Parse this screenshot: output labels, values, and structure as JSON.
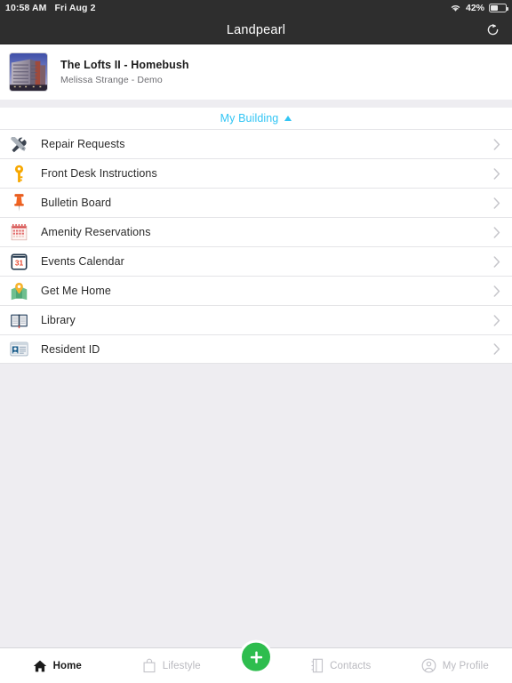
{
  "status_bar": {
    "time": "10:58 AM",
    "date": "Fri Aug 2",
    "wifi_icon": "wifi-icon",
    "battery_percent": "42%",
    "battery_icon": "battery-icon"
  },
  "nav_bar": {
    "title": "Landpearl",
    "refresh_icon": "refresh-icon"
  },
  "building": {
    "thumbnail_icon": "building-photo",
    "name": "The Lofts II - Homebush",
    "subtitle": "Melissa Strange - Demo"
  },
  "section": {
    "label": "My Building",
    "caret_icon": "caret-up-icon",
    "expanded": true
  },
  "menu_items": [
    {
      "label": "Repair Requests",
      "icon": "tools-icon",
      "chevron": "chevron-right-icon"
    },
    {
      "label": "Front Desk Instructions",
      "icon": "key-icon",
      "chevron": "chevron-right-icon"
    },
    {
      "label": "Bulletin Board",
      "icon": "pushpin-icon",
      "chevron": "chevron-right-icon"
    },
    {
      "label": "Amenity Reservations",
      "icon": "calendar-grid-icon",
      "chevron": "chevron-right-icon"
    },
    {
      "label": "Events Calendar",
      "icon": "calendar-31-icon",
      "chevron": "chevron-right-icon"
    },
    {
      "label": "Get Me Home",
      "icon": "map-pin-icon",
      "chevron": "chevron-right-icon"
    },
    {
      "label": "Library",
      "icon": "open-book-icon",
      "chevron": "chevron-right-icon"
    },
    {
      "label": "Resident ID",
      "icon": "id-card-icon",
      "chevron": "chevron-right-icon"
    }
  ],
  "tab_bar": {
    "tabs": [
      {
        "label": "Home",
        "icon": "home-icon",
        "active": true
      },
      {
        "label": "Lifestyle",
        "icon": "shopping-bag-icon",
        "active": false
      },
      {
        "label": "Contacts",
        "icon": "address-book-icon",
        "active": false
      },
      {
        "label": "My Profile",
        "icon": "person-circle-icon",
        "active": false
      }
    ],
    "fab": {
      "icon": "plus-icon",
      "label": "+"
    }
  },
  "colors": {
    "nav_background": "#2e2e2e",
    "accent_cyan": "#32c5f4",
    "fab_green": "#2ebd4e",
    "page_background": "#eeedf1",
    "list_background": "#ffffff"
  }
}
